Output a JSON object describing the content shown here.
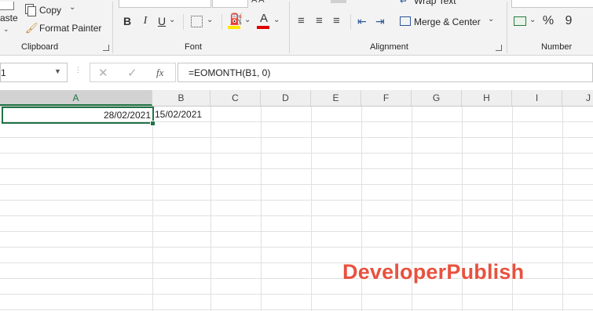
{
  "ribbon": {
    "clipboard": {
      "paste_label": "aste",
      "copy_label": "Copy",
      "format_painter_label": "Format Painter",
      "group_label": "Clipboard"
    },
    "font": {
      "bold": "B",
      "italic": "I",
      "underline": "U",
      "font_color_glyph": "A",
      "group_label": "Font"
    },
    "alignment": {
      "wrap_text_label": "Wrap Text",
      "merge_center_label": "Merge & Center",
      "group_label": "Alignment"
    },
    "number": {
      "percent": "%",
      "comma": "9",
      "group_label": "Number"
    }
  },
  "formula_bar": {
    "name_box": "1",
    "fx": "fx",
    "formula": "=EOMONTH(B1, 0)"
  },
  "columns": [
    "A",
    "B",
    "C",
    "D",
    "E",
    "F",
    "G",
    "H",
    "I",
    "J"
  ],
  "cells": {
    "A1": "28/02/2021",
    "B1": "15/02/2021"
  },
  "watermark": "DeveloperPublish"
}
